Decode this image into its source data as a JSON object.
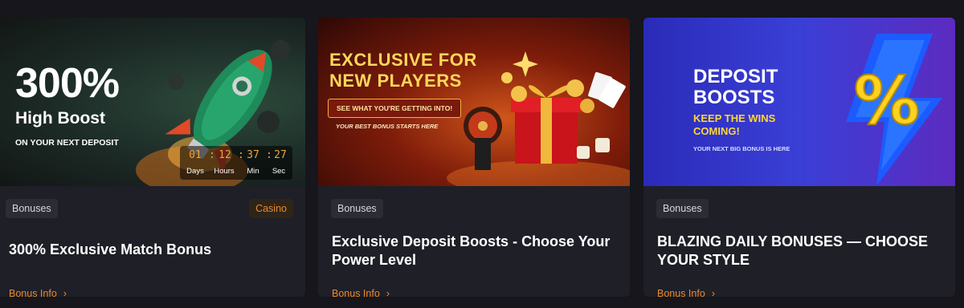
{
  "cards": [
    {
      "banner": {
        "headline": "300%",
        "subline": "High Boost",
        "note": "ON YOUR NEXT DEPOSIT",
        "timer": {
          "values": [
            "01",
            "12",
            "37",
            "27"
          ],
          "labels": [
            "Days",
            "Hours",
            "Min",
            "Sec"
          ]
        }
      },
      "tags": [
        "Bonuses",
        "Casino"
      ],
      "title": "300% Exclusive Match Bonus",
      "info_link": "Bonus Info"
    },
    {
      "banner": {
        "headline_1": "EXCLUSIVE FOR",
        "headline_2": "NEW PLAYERS",
        "cta": "SEE WHAT YOU'RE GETTING INTO!",
        "footer": "YOUR BEST BONUS STARTS HERE"
      },
      "tags": [
        "Bonuses"
      ],
      "title": "Exclusive Deposit Boosts - Choose Your Power Level",
      "info_link": "Bonus Info"
    },
    {
      "banner": {
        "headline_1": "DEPOSIT",
        "headline_2": "BOOSTS",
        "kicker_1": "KEEP THE WINS",
        "kicker_2": "COMING!",
        "footer": "YOUR NEXT BIG BONUS IS HERE",
        "symbol": "%"
      },
      "tags": [
        "Bonuses"
      ],
      "title": "BLAZING DAILY BONUSES — CHOOSE YOUR STYLE",
      "info_link": "Bonus Info"
    }
  ],
  "chevron_glyph": "›",
  "colors": {
    "accent": "#e8892c",
    "card_bg": "#1f1f27",
    "page_bg": "#16161c",
    "tag_bg": "#2c2c36"
  }
}
